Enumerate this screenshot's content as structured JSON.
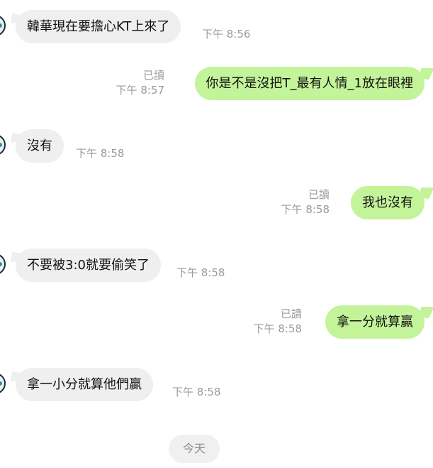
{
  "messages": [
    {
      "side": "in",
      "text": "韓華現在要擔心KT上來了",
      "time": "下午 8:56"
    },
    {
      "side": "out",
      "text": "你是不是沒把T_最有人情_1放在眼裡",
      "time": "下午 8:57",
      "read": "已讀"
    },
    {
      "side": "in",
      "text": "沒有",
      "time": "下午 8:58"
    },
    {
      "side": "out",
      "text": "我也沒有",
      "time": "下午 8:58",
      "read": "已讀"
    },
    {
      "side": "in",
      "text": "不要被3:0就要偷笑了",
      "time": "下午 8:58"
    },
    {
      "side": "out",
      "text": "拿一分就算贏",
      "time": "下午 8:58",
      "read": "已讀"
    },
    {
      "side": "in",
      "text": "拿一小分就算他們贏",
      "time": "下午 8:58"
    }
  ],
  "date_divider": "今天"
}
